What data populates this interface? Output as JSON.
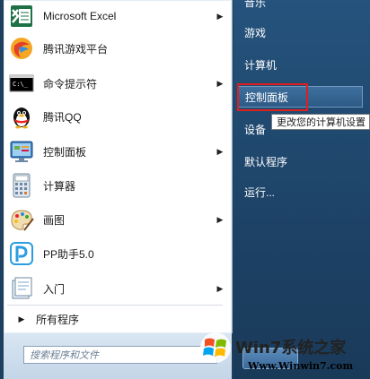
{
  "start_menu": {
    "programs": [
      {
        "label": "Microsoft Excel",
        "icon": "excel-icon",
        "has_submenu": true
      },
      {
        "label": "腾讯游戏平台",
        "icon": "tencent-games-icon",
        "has_submenu": false
      },
      {
        "label": "命令提示符",
        "icon": "cmd-icon",
        "has_submenu": true
      },
      {
        "label": "腾讯QQ",
        "icon": "qq-penguin-icon",
        "has_submenu": false
      },
      {
        "label": "控制面板",
        "icon": "control-panel-icon",
        "has_submenu": true
      },
      {
        "label": "计算器",
        "icon": "calculator-icon",
        "has_submenu": false
      },
      {
        "label": "画图",
        "icon": "paint-icon",
        "has_submenu": true
      },
      {
        "label": "PP助手5.0",
        "icon": "pp-assistant-icon",
        "has_submenu": false
      },
      {
        "label": "入门",
        "icon": "getting-started-icon",
        "has_submenu": true
      }
    ],
    "all_programs_label": "所有程序",
    "search_placeholder": "搜索程序和文件",
    "right_items": {
      "top_partial": "音乐",
      "games": "游戏",
      "computer": "计算机",
      "control_panel": "控制面板",
      "devices_partial": "设备",
      "default_programs": "默认程序",
      "run": "运行..."
    },
    "tooltip": "更改您的计算机设置",
    "highlighted_item": "控制面板"
  },
  "watermark": {
    "brand_text": "Win7系统之家",
    "url_text": "Www.Winwin7.com"
  },
  "colors": {
    "right_panel": "#25537d",
    "highlight_box": "#e01e1e",
    "excel_green": "#1e7145"
  }
}
